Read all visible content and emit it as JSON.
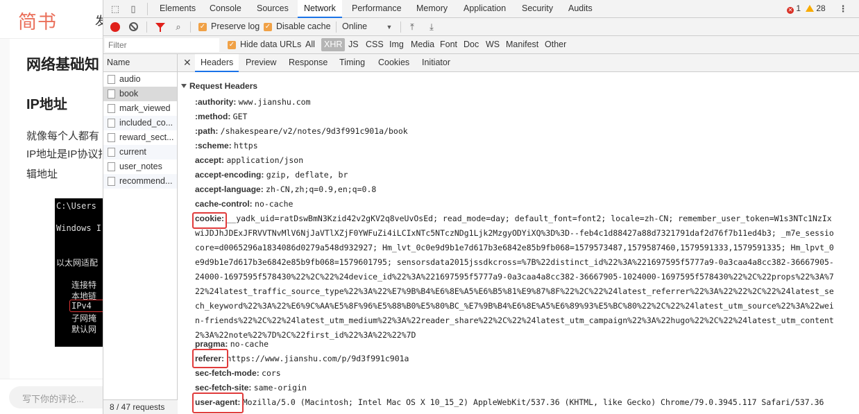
{
  "article": {
    "logo": "简书",
    "nav": "发",
    "title": "网络基础知",
    "subtitle": "IP地址",
    "lines": [
      "就像每个人都有",
      "IP地址是IP协议指",
      "辑地址"
    ],
    "screenshot_lines": [
      "C:\\Users",
      "Windows I",
      "以太网适配",
      "连接特",
      "本地链",
      "IPv4",
      "子网掩",
      "默认网"
    ],
    "comment_placeholder": "写下你的评论..."
  },
  "devtools": {
    "panels": [
      "Elements",
      "Console",
      "Sources",
      "Network",
      "Performance",
      "Memory",
      "Application",
      "Security",
      "Audits"
    ],
    "active_panel": "Network",
    "error_count": "1",
    "warning_count": "28",
    "network_toolbar": {
      "preserve_log": "Preserve log",
      "disable_cache": "Disable cache",
      "throttle": "Online"
    },
    "filter": {
      "placeholder": "Filter",
      "hide_data_urls": "Hide data URLs",
      "types": [
        "All",
        "XHR",
        "JS",
        "CSS",
        "Img",
        "Media",
        "Font",
        "Doc",
        "WS",
        "Manifest",
        "Other"
      ],
      "active_type": "XHR"
    },
    "requests": {
      "header": "Name",
      "items": [
        "audio",
        "book",
        "mark_viewed",
        "included_co...",
        "reward_sect...",
        "current",
        "user_notes",
        "recommend..."
      ],
      "selected": "book",
      "footer": "8 / 47 requests"
    },
    "detail_tabs": [
      "Headers",
      "Preview",
      "Response",
      "Timing",
      "Cookies",
      "Initiator"
    ],
    "active_detail_tab": "Headers",
    "section_title": "Request Headers",
    "headers_before": [
      {
        "k": ":authority:",
        "v": "www.jianshu.com"
      },
      {
        "k": ":method:",
        "v": "GET"
      },
      {
        "k": ":path:",
        "v": "/shakespeare/v2/notes/9d3f991c901a/book"
      },
      {
        "k": ":scheme:",
        "v": "https"
      },
      {
        "k": "accept:",
        "v": "application/json"
      },
      {
        "k": "accept-encoding:",
        "v": "gzip, deflate, br"
      },
      {
        "k": "accept-language:",
        "v": "zh-CN,zh;q=0.9,en;q=0.8"
      },
      {
        "k": "cache-control:",
        "v": "no-cache"
      }
    ],
    "cookie": {
      "k": "cookie:",
      "v": "__yadk_uid=ratDswBmN3Kzid42v2gKV2q8veUvOsEd; read_mode=day; default_font=font2; locale=zh-CN; remember_user_token=W1s3NTc1NzIx",
      "continuation": [
        "wiJDJhJDExJFRVVTNvMlV6NjJaVTlXZjF0YWFuZi4iLCIxNTc5NTczNDg1Ljk2MzgyODYiXQ%3D%3D--feb4c1d88427a88d7321791daf2d76f7b11ed4b3; _m7e_sessio",
        "core=d0065296a1834086d0279a548d932927; Hm_lvt_0c0e9d9b1e7d617b3e6842e85b9fb068=1579573487,1579587460,1579591333,1579591335; Hm_lpvt_0",
        "e9d9b1e7d617b3e6842e85b9fb068=1579601795; sensorsdata2015jssdkcross=%7B%22distinct_id%22%3A%221697595f5777a9-0a3caa4a8cc382-36667905-",
        "24000-1697595f578430%22%2C%22%24device_id%22%3A%221697595f5777a9-0a3caa4a8cc382-36667905-1024000-1697595f578430%22%2C%22props%22%3A%7",
        "22%24latest_traffic_source_type%22%3A%22%E7%9B%B4%E6%8E%A5%E6%B5%81%E9%87%8F%22%2C%22%24latest_referrer%22%3A%22%22%2C%22%24latest_se",
        "ch_keyword%22%3A%22%E6%9C%AA%E5%8F%96%E5%88%B0%E5%80%BC_%E7%9B%B4%E6%8E%A5%E6%89%93%E5%BC%80%22%2C%22%24latest_utm_source%22%3A%22wei",
        "n-friends%22%2C%22%24latest_utm_medium%22%3A%22reader_share%22%2C%22%24latest_utm_campaign%22%3A%22hugo%22%2C%22%24latest_utm_content",
        "2%3A%22note%22%7D%2C%22first_id%22%3A%22%22%7D"
      ]
    },
    "headers_after": [
      {
        "k": "pragma:",
        "v": "no-cache"
      },
      {
        "k": "referer:",
        "v": "https://www.jianshu.com/p/9d3f991c901a",
        "highlight": true
      },
      {
        "k": "sec-fetch-mode:",
        "v": "cors"
      },
      {
        "k": "sec-fetch-site:",
        "v": "same-origin"
      },
      {
        "k": "user-agent:",
        "v": "Mozilla/5.0 (Macintosh; Intel Mac OS X 10_15_2) AppleWebKit/537.36 (KHTML, like Gecko) Chrome/79.0.3945.117 Safari/537.36",
        "highlight": true
      }
    ],
    "colors": {
      "accent": "#1a73e8",
      "record": "#e0201a",
      "checkbox": "#f0a146",
      "highlight": "#e03b3b",
      "brand": "#ea6f5a"
    }
  }
}
